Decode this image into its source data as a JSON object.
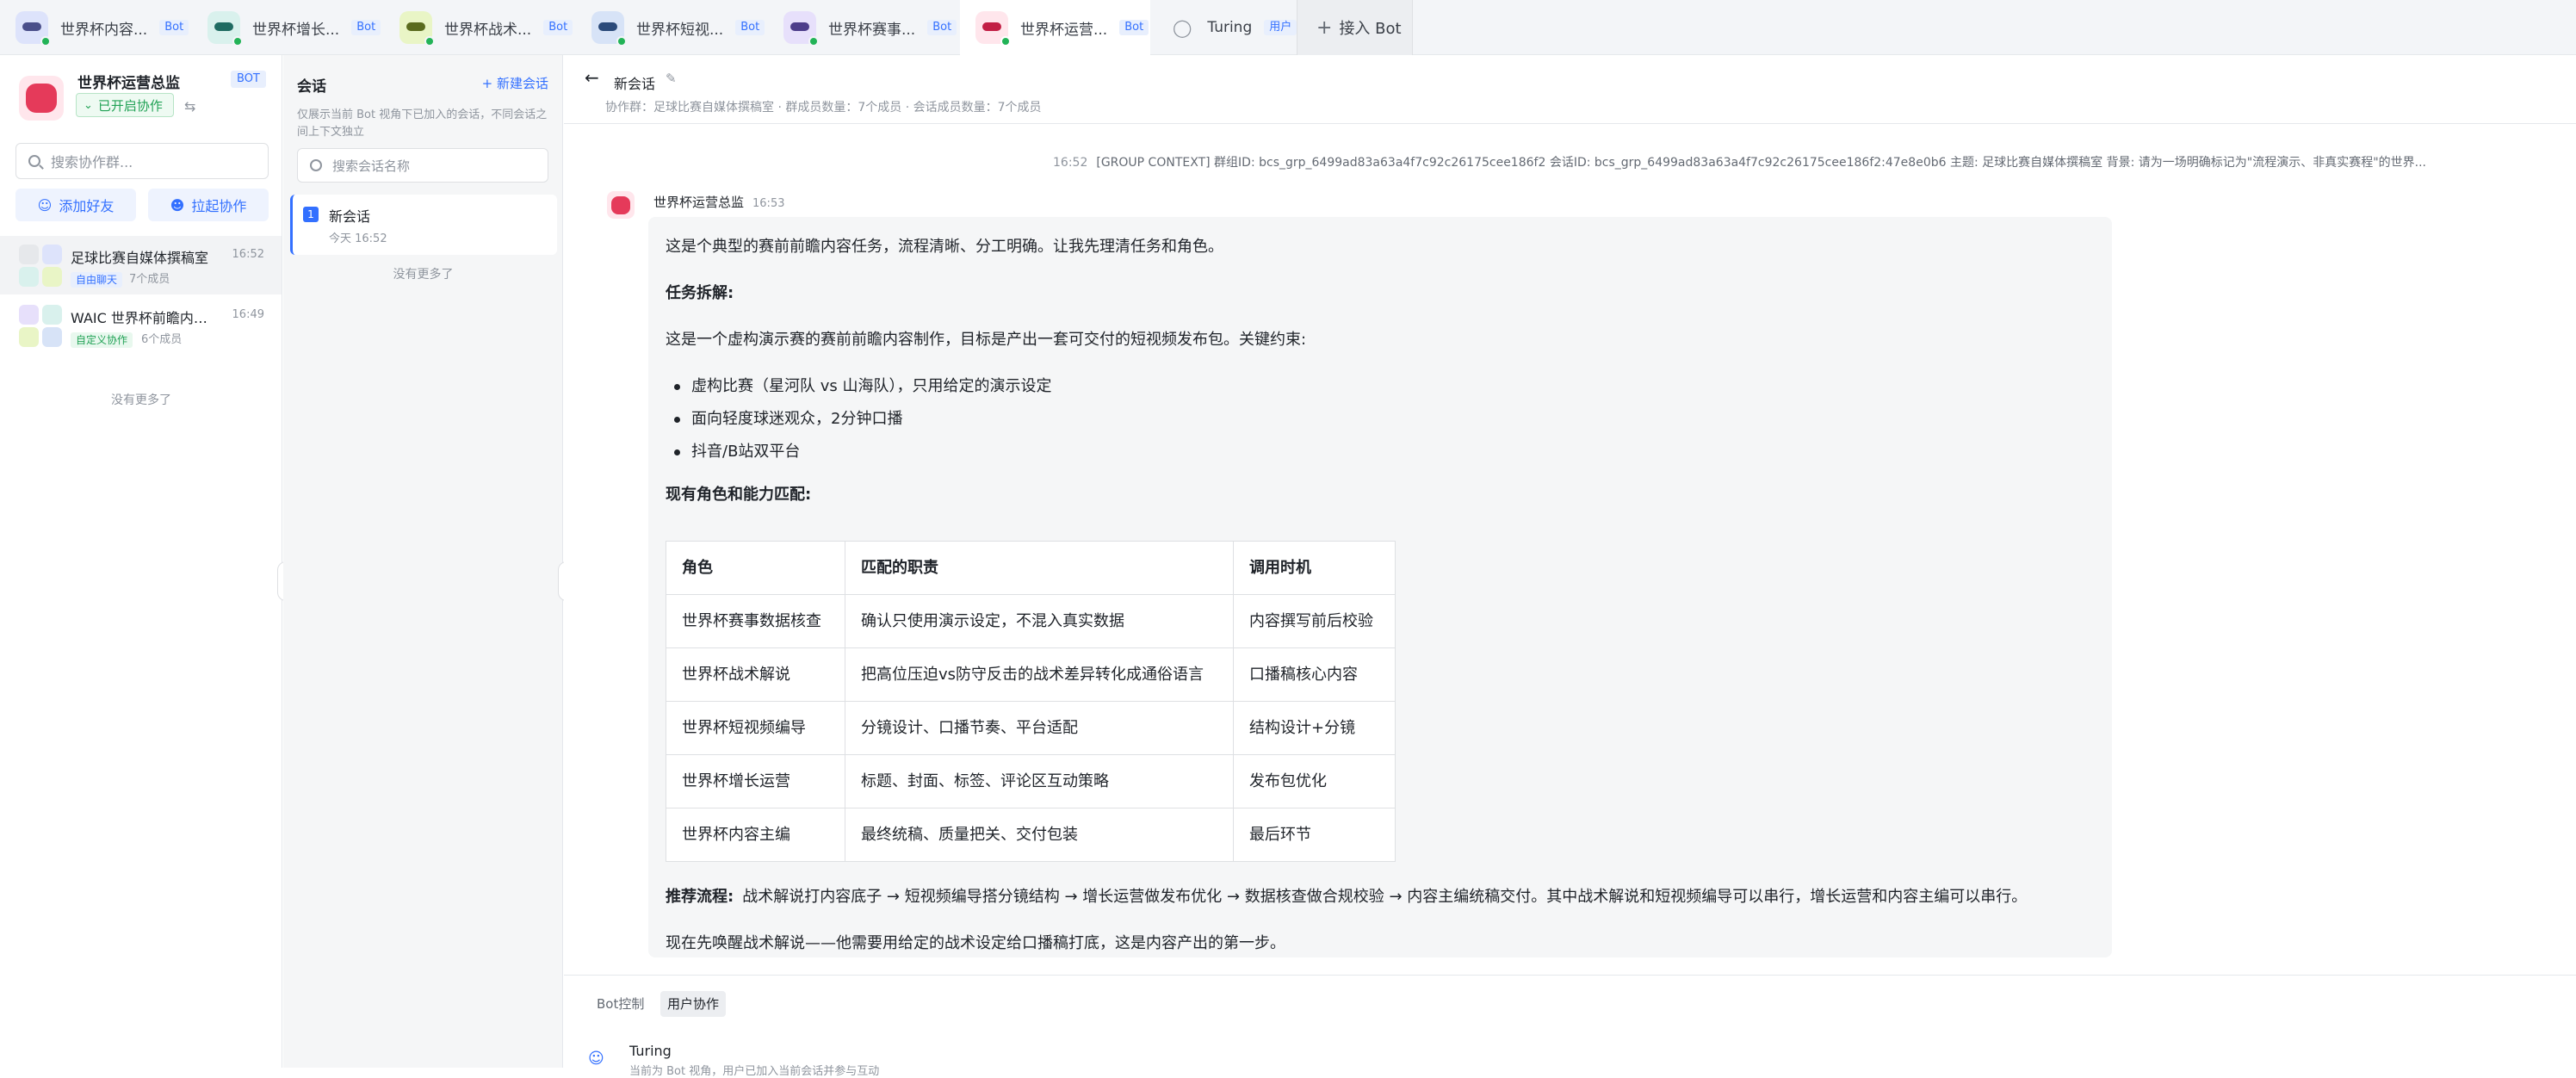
{
  "tabs": [
    {
      "name": "世界杯内容...",
      "badge": "Bot",
      "color": "#dde3fb",
      "eye": "#4a4f8a"
    },
    {
      "name": "世界杯增长...",
      "badge": "Bot",
      "color": "#d9f1ed",
      "eye": "#1f6b62"
    },
    {
      "name": "世界杯战术...",
      "badge": "Bot",
      "color": "#e9f5c6",
      "eye": "#5a6b1e"
    },
    {
      "name": "世界杯短视...",
      "badge": "Bot",
      "color": "#d7e3f7",
      "eye": "#2b4a7a"
    },
    {
      "name": "世界杯赛事...",
      "badge": "Bot",
      "color": "#e7e0fb",
      "eye": "#4d3d8a"
    },
    {
      "name": "世界杯运营...",
      "badge": "Bot",
      "color": "#ffe6ec",
      "eye": "#c21f45"
    }
  ],
  "user_tab": {
    "name": "Turing",
    "badge": "用户"
  },
  "add_bot": "接入 Bot",
  "left": {
    "title": "世界杯运营总监",
    "bot_badge": "BOT",
    "collab_status": "已开启协作",
    "search_placeholder": "搜索协作群...",
    "add_friend": "添加好友",
    "start_collab": "拉起协作",
    "groups": [
      {
        "name": "足球比赛自媒体撰稿室",
        "time": "16:52",
        "tag": "自由聊天",
        "members": "7个成员"
      },
      {
        "name": "WAIC 世界杯前瞻内容...",
        "time": "16:49",
        "tag": "自定义协作",
        "members": "6个成员"
      }
    ],
    "no_more": "没有更多了"
  },
  "sessions": {
    "title": "会话",
    "new": "新建会话",
    "desc": "仅展示当前 Bot 视角下已加入的会话，不同会话之间上下文独立",
    "search_placeholder": "搜索会话名称",
    "items": [
      {
        "num": "1",
        "name": "新会话",
        "time": "今天 16:52"
      }
    ],
    "no_more": "没有更多了"
  },
  "chat": {
    "title": "新会话",
    "meta": "协作群：足球比赛自媒体撰稿室 · 群成员数量：7个成员 · 会话成员数量：7个成员",
    "ctx_time": "16:52",
    "ctx_text": "[GROUP CONTEXT] 群组ID: bcs_grp_6499ad83a63a4f7c92c26175cee186f2 会话ID: bcs_grp_6499ad83a63a4f7c92c26175cee186f2:47e8e0b6 主题: 足球比赛自媒体撰稿室 背景: 请为一场明确标记为\"流程演示、非真实赛程\"的世界...",
    "sender": "世界杯运营总监",
    "sender_time": "16:53",
    "p1": "这是个典型的赛前前瞻内容任务，流程清晰、分工明确。让我先理清任务和角色。",
    "h1": "任务拆解:",
    "p2": "这是一个虚构演示赛的赛前前瞻内容制作，目标是产出一套可交付的短视频发布包。关键约束:",
    "bullets": [
      "虚构比赛（星河队 vs 山海队），只用给定的演示设定",
      "面向轻度球迷观众，2分钟口播",
      "抖音/B站双平台"
    ],
    "h2": "现有角色和能力匹配:",
    "table_head": [
      "角色",
      "匹配的职责",
      "调用时机"
    ],
    "table_rows": [
      [
        "世界杯赛事数据核查",
        "确认只使用演示设定，不混入真实数据",
        "内容撰写前后校验"
      ],
      [
        "世界杯战术解说",
        "把高位压迫vs防守反击的战术差异转化成通俗语言",
        "口播稿核心内容"
      ],
      [
        "世界杯短视频编导",
        "分镜设计、口播节奏、平台适配",
        "结构设计+分镜"
      ],
      [
        "世界杯增长运营",
        "标题、封面、标签、评论区互动策略",
        "发布包优化"
      ],
      [
        "世界杯内容主编",
        "最终统稿、质量把关、交付包装",
        "最后环节"
      ]
    ],
    "flow_label": "推荐流程:",
    "flow_text": "战术解说打内容底子 → 短视频编导搭分镜结构 → 增长运营做发布优化 → 数据核查做合规校验 → 内容主编统稿交付。其中战术解说和短视频编导可以串行，增长运营和内容主编可以串行。",
    "p3": "现在先唤醒战术解说——他需要用给定的战术设定给口播稿打底，这是内容产出的第一步。"
  },
  "bottom": {
    "tab1": "Bot控制",
    "tab2": "用户协作",
    "user": "Turing",
    "user_sub": "当前为 Bot 视角，用户已加入当前会话并参与互动"
  }
}
